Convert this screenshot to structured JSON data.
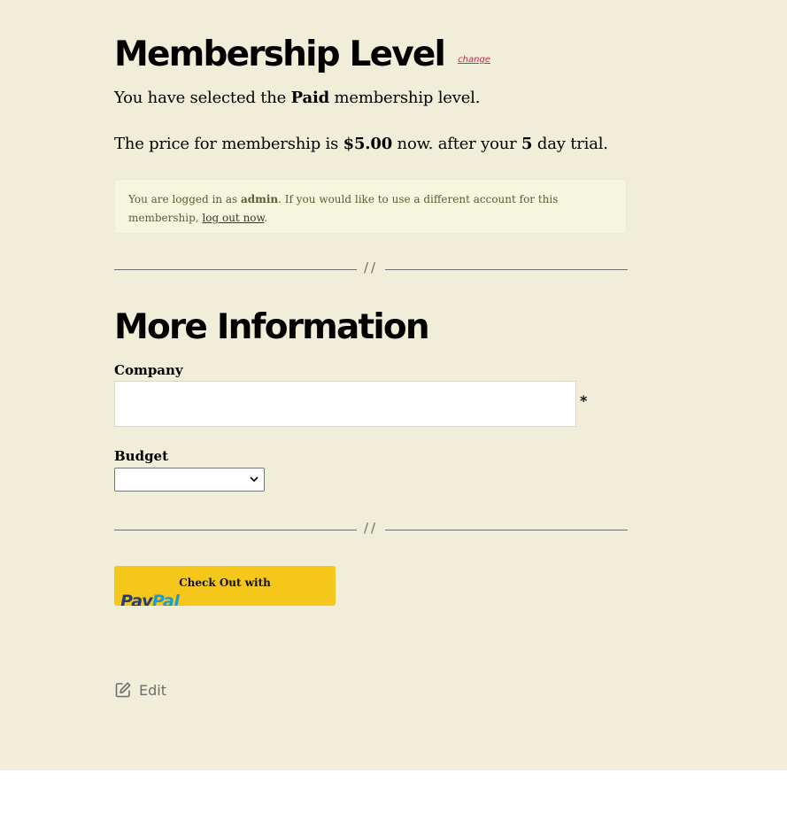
{
  "membership": {
    "heading": "Membership Level",
    "change_link": "change",
    "selected_prefix": "You have selected the ",
    "level_name": "Paid",
    "selected_suffix": " membership level.",
    "price_prefix": "The price for membership is ",
    "price": "$5.00",
    "price_middle": " now. after your ",
    "trial_days": "5",
    "price_suffix": " day trial."
  },
  "notice": {
    "prefix": "You are logged in as ",
    "username": "admin",
    "middle": ". If you would like to use a different account for this membership, ",
    "logout_link": "log out now",
    "suffix": "."
  },
  "separator": {
    "glyph": "//"
  },
  "more_info": {
    "heading": "More Information",
    "company_label": "Company",
    "company_value": "",
    "required_marker": "*",
    "budget_label": "Budget",
    "budget_selected": ""
  },
  "checkout": {
    "button_text": "Check Out with",
    "logo_pay": "Pay",
    "logo_pal": "Pal"
  },
  "footer": {
    "edit_label": "Edit",
    "edit_icon": "edit-icon"
  },
  "colors": {
    "page_background": "#f0edd9",
    "accent_link": "#cd2653",
    "notice_background": "#f5f6de",
    "paypal_button": "#f5c71a"
  }
}
